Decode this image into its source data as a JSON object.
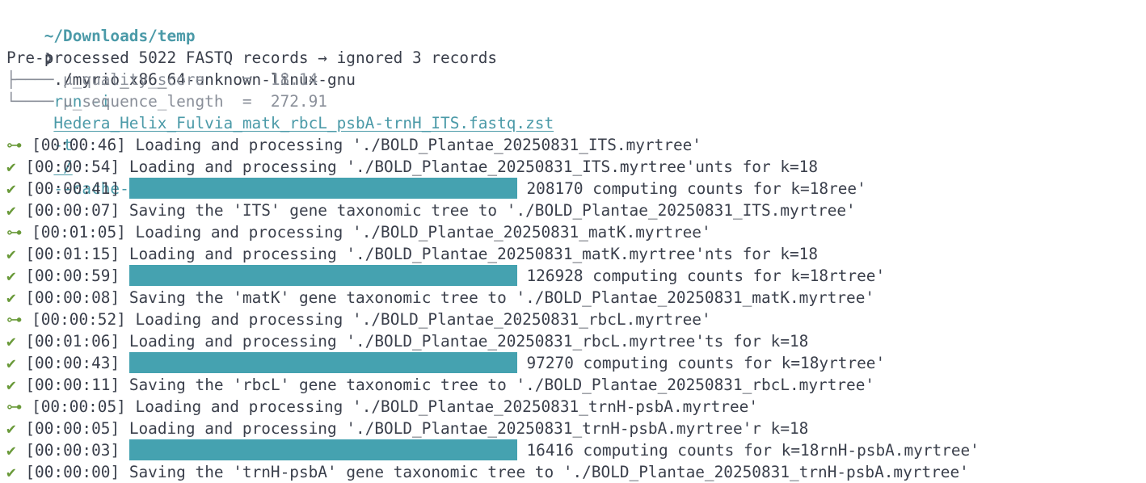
{
  "terminal": {
    "cwd": "~/Downloads/temp",
    "prompt_symbol": "❯",
    "command": {
      "program": "./myrio_x86_64-unknown-linux-gnu",
      "subcommand": "run -i",
      "input_file": "Hedera_Helix_Fulvia_matk_rbcL_psbA-trnH_ITS.fastq.zst",
      "t_flag": "-t",
      "t_value": "./",
      "extra_flag": "--cache-counts"
    },
    "summary": "Pre-processed 5022 FASTQ records → ignored 3 records",
    "stats": [
      {
        "branch": "├──── ",
        "text": "μ_quality_score    =  18.14"
      },
      {
        "branch": "└──── ",
        "text": "μ_sequence_length  =  272.91"
      }
    ],
    "rows": [
      {
        "type": "text",
        "icon": "⊶",
        "icon_name": "key-icon",
        "time": "[00:00:46]",
        "text": "Loading and processing './BOLD_Plantae_20250831_ITS.myrtree'"
      },
      {
        "type": "text",
        "icon": "✔",
        "icon_name": "check-icon",
        "time": "[00:00:54]",
        "text": "Loading and processing './BOLD_Plantae_20250831_ITS.myrtree'unts for k=18"
      },
      {
        "type": "bar",
        "icon": "✔",
        "icon_name": "check-icon",
        "time": "[00:00:41]",
        "progress": 1.0,
        "text": "208170 computing counts for k=18ree'"
      },
      {
        "type": "text",
        "icon": "✔",
        "icon_name": "check-icon",
        "time": "[00:00:07]",
        "text": "Saving the 'ITS' gene taxonomic tree to './BOLD_Plantae_20250831_ITS.myrtree'"
      },
      {
        "type": "text",
        "icon": "⊶",
        "icon_name": "key-icon",
        "time": "[00:01:05]",
        "text": "Loading and processing './BOLD_Plantae_20250831_matK.myrtree'"
      },
      {
        "type": "text",
        "icon": "✔",
        "icon_name": "check-icon",
        "time": "[00:01:15]",
        "text": "Loading and processing './BOLD_Plantae_20250831_matK.myrtree'nts for k=18"
      },
      {
        "type": "bar",
        "icon": "✔",
        "icon_name": "check-icon",
        "time": "[00:00:59]",
        "progress": 1.0,
        "text": "126928 computing counts for k=18rtree'"
      },
      {
        "type": "text",
        "icon": "✔",
        "icon_name": "check-icon",
        "time": "[00:00:08]",
        "text": "Saving the 'matK' gene taxonomic tree to './BOLD_Plantae_20250831_matK.myrtree'"
      },
      {
        "type": "text",
        "icon": "⊶",
        "icon_name": "key-icon",
        "time": "[00:00:52]",
        "text": "Loading and processing './BOLD_Plantae_20250831_rbcL.myrtree'"
      },
      {
        "type": "text",
        "icon": "✔",
        "icon_name": "check-icon",
        "time": "[00:01:06]",
        "text": "Loading and processing './BOLD_Plantae_20250831_rbcL.myrtree'ts for k=18"
      },
      {
        "type": "bar",
        "icon": "✔",
        "icon_name": "check-icon",
        "time": "[00:00:43]",
        "progress": 1.0,
        "text": "97270 computing counts for k=18yrtree'"
      },
      {
        "type": "text",
        "icon": "✔",
        "icon_name": "check-icon",
        "time": "[00:00:11]",
        "text": "Saving the 'rbcL' gene taxonomic tree to './BOLD_Plantae_20250831_rbcL.myrtree'"
      },
      {
        "type": "text",
        "icon": "⊶",
        "icon_name": "key-icon",
        "time": "[00:00:05]",
        "text": "Loading and processing './BOLD_Plantae_20250831_trnH-psbA.myrtree'"
      },
      {
        "type": "text",
        "icon": "✔",
        "icon_name": "check-icon",
        "time": "[00:00:05]",
        "text": "Loading and processing './BOLD_Plantae_20250831_trnH-psbA.myrtree'r k=18"
      },
      {
        "type": "bar",
        "icon": "✔",
        "icon_name": "check-icon",
        "time": "[00:00:03]",
        "progress": 1.0,
        "text": "16416 computing counts for k=18rnH-psbA.myrtree'"
      },
      {
        "type": "text",
        "icon": "✔",
        "icon_name": "check-icon",
        "time": "[00:00:00]",
        "text": "Saving the 'trnH-psbA' gene taxonomic tree to './BOLD_Plantae_20250831_trnH-psbA.myrtree'"
      }
    ],
    "colors": {
      "background": "#ffffff",
      "foreground": "#3a3f4b",
      "accent": "#4b9aa8",
      "progress_bar": "#45a2b0",
      "success": "#6a9a3a"
    }
  }
}
